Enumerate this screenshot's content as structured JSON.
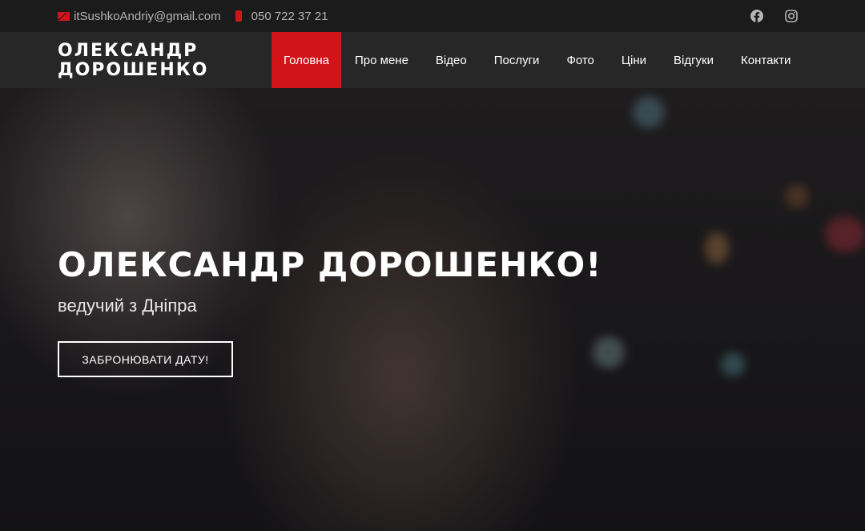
{
  "topbar": {
    "email": "itSushkoAndriy@gmail.com",
    "phone": "050 722 37 21",
    "icons": [
      "mail-icon",
      "phone-icon",
      "facebook-icon",
      "instagram-icon"
    ]
  },
  "header": {
    "logo_line1": "ОЛЕКСАНДР",
    "logo_line2": "ДОРОШЕНКО"
  },
  "nav": {
    "items": [
      {
        "label": "Головна",
        "active": true
      },
      {
        "label": "Про мене"
      },
      {
        "label": "Відео"
      },
      {
        "label": "Послуги"
      },
      {
        "label": "Фото"
      },
      {
        "label": "Ціни"
      },
      {
        "label": "Відгуки"
      },
      {
        "label": "Контакти"
      }
    ]
  },
  "hero": {
    "title": "ОЛЕКСАНДР ДОРОШЕНКО!",
    "subtitle": "ведучий з Дніпра",
    "button": "ЗАБРОНЮВАТИ ДАТУ!"
  },
  "colors": {
    "accent": "#d2141a",
    "topbar_bg": "#1b1b1b",
    "navbar_bg": "#272727"
  }
}
